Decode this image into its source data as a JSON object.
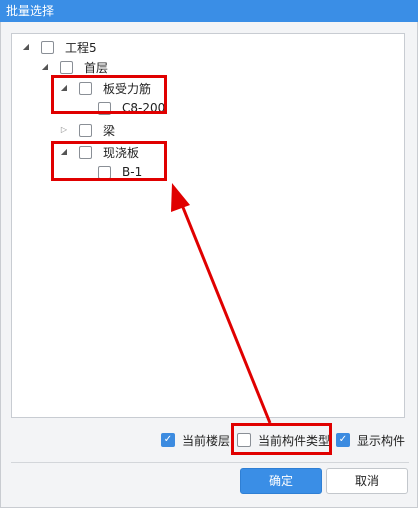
{
  "window": {
    "title": "批量选择"
  },
  "tree": {
    "root": {
      "label": "工程5"
    },
    "floor": {
      "label": "首层"
    },
    "group1": {
      "label": "板受力筋"
    },
    "group1_item": {
      "label": "C8-200"
    },
    "group2": {
      "label": "梁"
    },
    "group3": {
      "label": "现浇板"
    },
    "group3_item": {
      "label": "B-1"
    }
  },
  "options": {
    "current_floor": {
      "label": "当前楼层",
      "checked": true
    },
    "current_type": {
      "label": "当前构件类型",
      "checked": false
    },
    "show_components": {
      "label": "显示构件",
      "checked": true
    }
  },
  "buttons": {
    "ok": "确定",
    "cancel": "取消"
  },
  "colors": {
    "accent": "#3a8ee6",
    "annotation": "#e00000"
  }
}
